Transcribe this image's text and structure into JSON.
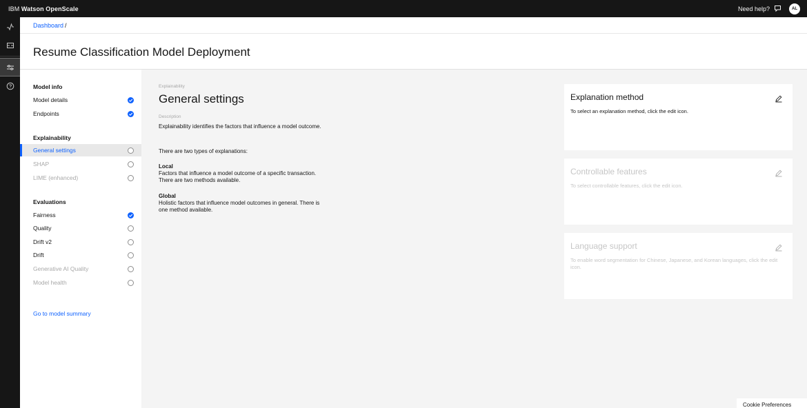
{
  "topbar": {
    "brand_prefix": "IBM",
    "brand_name": "Watson OpenScale",
    "help_label": "Need help?",
    "avatar_initials": "AL"
  },
  "rail": {
    "icons": [
      "activity-icon",
      "deployment-icon",
      "settings-sliders-icon",
      "help-icon"
    ]
  },
  "breadcrumb": {
    "link": "Dashboard",
    "separator": "/"
  },
  "page_title": "Resume Classification Model Deployment",
  "sidenav": {
    "sections": [
      {
        "title": "Model info",
        "items": [
          {
            "label": "Model details",
            "status": "complete"
          },
          {
            "label": "Endpoints",
            "status": "complete"
          }
        ]
      },
      {
        "title": "Explainability",
        "items": [
          {
            "label": "General settings",
            "status": "incomplete",
            "active": true
          },
          {
            "label": "SHAP",
            "status": "incomplete",
            "disabled": true
          },
          {
            "label": "LIME (enhanced)",
            "status": "incomplete",
            "disabled": true
          }
        ]
      },
      {
        "title": "Evaluations",
        "items": [
          {
            "label": "Fairness",
            "status": "complete"
          },
          {
            "label": "Quality",
            "status": "incomplete"
          },
          {
            "label": "Drift v2",
            "status": "incomplete"
          },
          {
            "label": "Drift",
            "status": "incomplete"
          },
          {
            "label": "Generative AI Quality",
            "status": "incomplete",
            "disabled": true
          },
          {
            "label": "Model health",
            "status": "incomplete",
            "disabled": true
          }
        ]
      }
    ],
    "summary_link": "Go to model summary"
  },
  "main": {
    "eyebrow": "Explainability",
    "title": "General settings",
    "description_label": "Description",
    "description": "Explainability identifies the factors that influence a model outcome.",
    "types_intro": "There are two types of explanations:",
    "types": [
      {
        "name": "Local",
        "text": "Factors that influence a model outcome of a specific transaction. There are two methods available."
      },
      {
        "name": "Global",
        "text": "Holistic factors that influence model outcomes in general. There is one method available."
      }
    ]
  },
  "cards": [
    {
      "title": "Explanation method",
      "text": "To select an explanation method, click the edit icon.",
      "disabled": false
    },
    {
      "title": "Controllable features",
      "text": "To select controllable features, click the edit icon.",
      "disabled": true
    },
    {
      "title": "Language support",
      "text": "To enable word segmentation for Chinese, Japanese, and Korean languages, click the edit icon.",
      "disabled": true
    }
  ],
  "cookie_label": "Cookie Preferences",
  "colors": {
    "accent": "#0f62fe",
    "topbar": "#161616",
    "content_bg": "#f4f4f4"
  }
}
